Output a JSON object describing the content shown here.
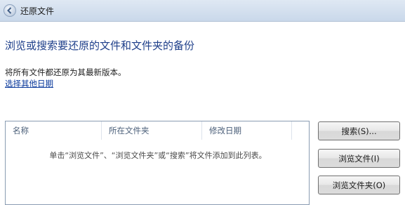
{
  "window": {
    "title": "还原文件"
  },
  "heading": "浏览或搜索要还原的文件和文件夹的备份",
  "info_text": "将所有文件都还原为其最新版本。",
  "choose_date_link": "选择其他日期",
  "list": {
    "columns": [
      "名称",
      "所在文件夹",
      "修改日期"
    ],
    "empty_message": "单击“浏览文件”、“浏览文件夹”或“搜索”将文件添加到此列表。"
  },
  "buttons": {
    "search": "搜索(S)...",
    "browse_files": "浏览文件(I)",
    "browse_folders": "浏览文件夹(O)"
  }
}
